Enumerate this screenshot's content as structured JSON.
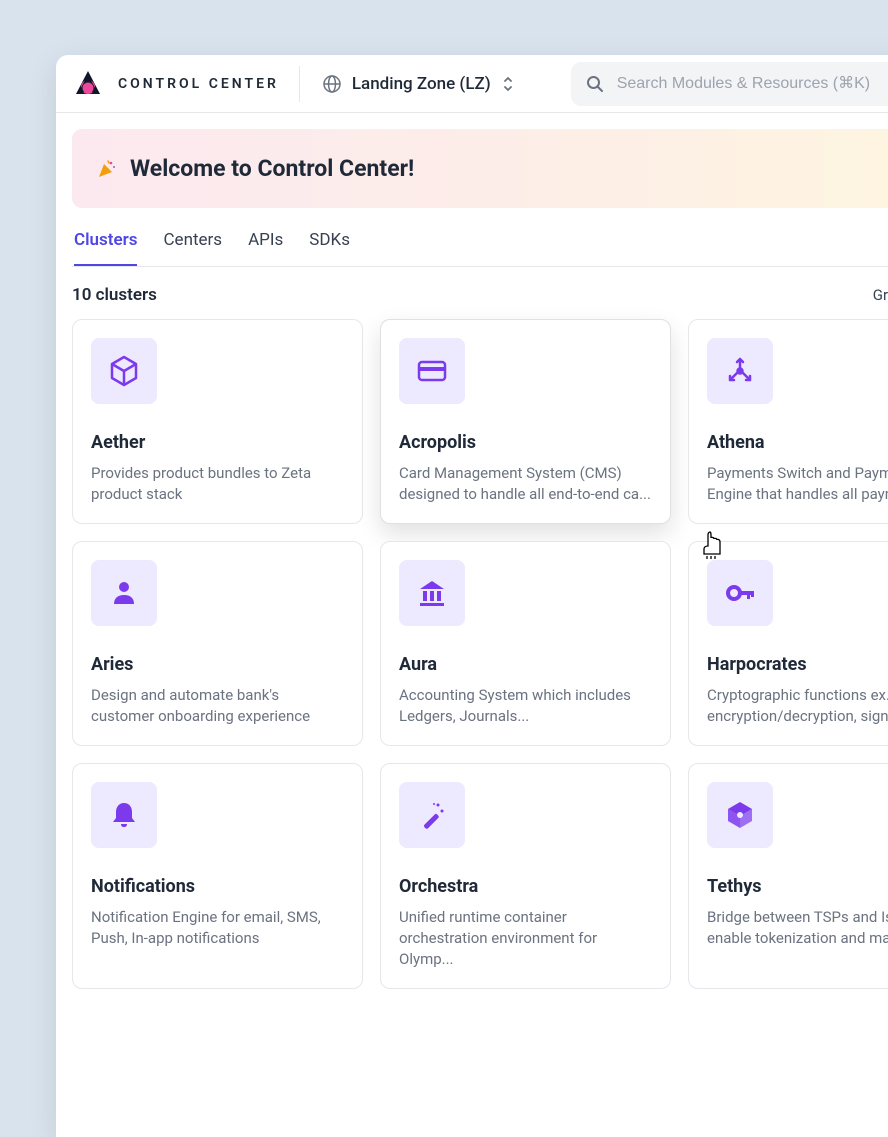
{
  "app": {
    "title": "CONTROL CENTER",
    "zone": "Landing Zone (LZ)",
    "search_placeholder": "Search Modules & Resources (⌘K)"
  },
  "banner": {
    "emoji": "🎉",
    "title": "Welcome to Control Center!"
  },
  "tabs": [
    {
      "label": "Clusters",
      "active": true
    },
    {
      "label": "Centers",
      "active": false
    },
    {
      "label": "APIs",
      "active": false
    },
    {
      "label": "SDKs",
      "active": false
    }
  ],
  "toolbar": {
    "count": "10 clusters",
    "groupby": "Group by:"
  },
  "clusters": [
    {
      "title": "Aether",
      "desc": "Provides product bundles to Zeta product stack",
      "icon": "cube"
    },
    {
      "title": "Acropolis",
      "desc": "Card Management System (CMS) designed to handle all end-to-end ca...",
      "icon": "card"
    },
    {
      "title": "Athena",
      "desc": "Payments Switch and Payments Engine that handles all paym...",
      "icon": "route"
    },
    {
      "title": "Aries",
      "desc": "Design and automate bank's customer onboarding experience",
      "icon": "person"
    },
    {
      "title": "Aura",
      "desc": "Accounting System which includes Ledgers, Journals...",
      "icon": "bank"
    },
    {
      "title": "Harpocrates",
      "desc": "Cryptographic functions ex. encryption/decryption, signin...",
      "icon": "key"
    },
    {
      "title": "Notifications",
      "desc": "Notification Engine for email, SMS, Push, In-app notifications",
      "icon": "bell"
    },
    {
      "title": "Orchestra",
      "desc": "Unified runtime container orchestration environment for Olymp...",
      "icon": "wand"
    },
    {
      "title": "Tethys",
      "desc": "Bridge between TSPs and Issuers to enable tokenization and mai...",
      "icon": "box3d"
    }
  ],
  "colors": {
    "accent": "#7c3aed",
    "icon_bg": "#ede9fe"
  }
}
